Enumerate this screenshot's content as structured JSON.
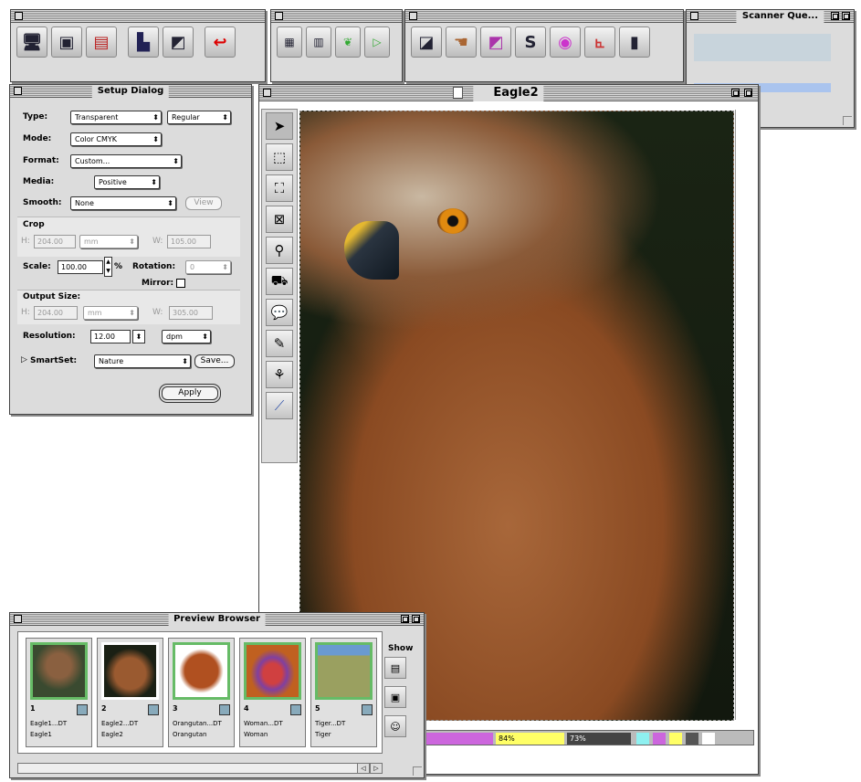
{
  "eagle_window": {
    "title": "Eagle2",
    "status": {
      "v1": "84%",
      "v2": "73%"
    }
  },
  "setup": {
    "title": "Setup Dialog",
    "type_label": "Type:",
    "type_value": "Transparent",
    "type2_value": "Regular",
    "mode_label": "Mode:",
    "mode_value": "Color CMYK",
    "format_label": "Format:",
    "format_value": "Custom...",
    "media_label": "Media:",
    "media_value": "Positive",
    "smooth_label": "Smooth:",
    "smooth_value": "None",
    "view_label": "View",
    "crop_label": "Crop",
    "h_label": "H:",
    "crop_h": "204.00",
    "crop_unit": "mm",
    "w_label": "W:",
    "crop_w": "105.00",
    "scale_label": "Scale:",
    "scale_value": "100.00",
    "pct": "%",
    "rotation_label": "Rotation:",
    "rotation_value": "0",
    "mirror_label": "Mirror:",
    "output_label": "Output Size:",
    "out_h": "204.00",
    "out_unit": "mm",
    "out_w": "305.00",
    "resolution_label": "Resolution:",
    "resolution_value": "12.00",
    "res_unit": "dpm",
    "smartset_label": "SmartSet:",
    "smartset_value": "Nature",
    "save_label": "Save...",
    "apply_label": "Apply"
  },
  "queue": {
    "title": "Scanner Que..."
  },
  "browser": {
    "title": "Preview Browser",
    "show_label": "Show",
    "items": [
      {
        "num": "1",
        "file": "Eagle1...DT",
        "name": "Eagle1"
      },
      {
        "num": "2",
        "file": "Eagle2...DT",
        "name": "Eagle2"
      },
      {
        "num": "3",
        "file": "Orangutan...DT",
        "name": "Orangutan"
      },
      {
        "num": "4",
        "file": "Woman...DT",
        "name": "Woman"
      },
      {
        "num": "5",
        "file": "Tiger...DT",
        "name": "Tiger"
      }
    ]
  },
  "colors": {
    "accent_green": "#66bb66",
    "status_magenta": "#cc66dd",
    "status_yellow": "#ffff66",
    "status_gray": "#444444"
  }
}
